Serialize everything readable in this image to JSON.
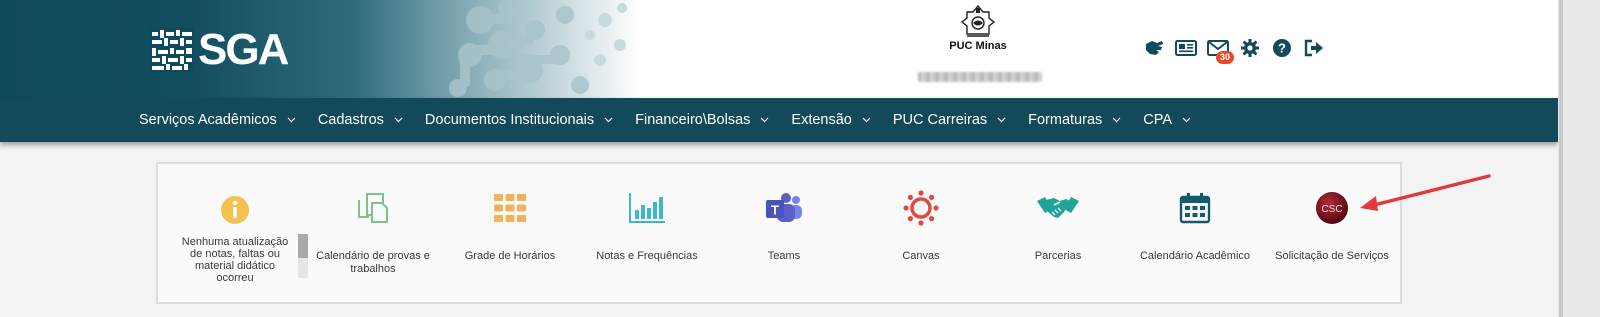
{
  "header": {
    "logo_text": "SGA",
    "institution_name": "PUC Minas",
    "toolbar": [
      {
        "icon": "sign-language-icon"
      },
      {
        "icon": "newspaper-icon"
      },
      {
        "icon": "envelope-icon",
        "badge": "30"
      },
      {
        "icon": "gear-icon"
      },
      {
        "icon": "help-circle-icon"
      },
      {
        "icon": "sign-out-icon"
      }
    ]
  },
  "nav": {
    "items": [
      {
        "label": "Serviços Acadêmicos"
      },
      {
        "label": "Cadastros"
      },
      {
        "label": "Documentos Institucionais"
      },
      {
        "label": "Financeiro\\Bolsas"
      },
      {
        "label": "Extensão"
      },
      {
        "label": "PUC Carreiras"
      },
      {
        "label": "Formaturas"
      },
      {
        "label": "CPA"
      }
    ]
  },
  "shortcuts": {
    "notice": "Nenhuma atualização de notas, faltas ou material didático ocorreu",
    "items": [
      {
        "label": "Calendário de provas e trabalhos",
        "icon": "copy-documents-icon",
        "color": "#7cc28a"
      },
      {
        "label": "Grade de Horários",
        "icon": "grid-icon",
        "color": "#f0b35c"
      },
      {
        "label": "Notas e Frequências",
        "icon": "bar-chart-icon",
        "color": "#3fb6c9"
      },
      {
        "label": "Teams",
        "icon": "teams-icon",
        "color": "#5b5fc7"
      },
      {
        "label": "Canvas",
        "icon": "canvas-icon",
        "color": "#e24a3b"
      },
      {
        "label": "Parcerias",
        "icon": "handshake-icon",
        "color": "#1fa39a"
      },
      {
        "label": "Calendário Acadêmico",
        "icon": "calendar-icon",
        "color": "#145a6e"
      },
      {
        "label": "Solicitação de Serviços",
        "icon": "csc-icon",
        "color": "#7a0f1c",
        "icon_text": "CSC"
      }
    ]
  },
  "colors": {
    "nav_bg": "#134a5a",
    "brand_dark": "#0f4a5b",
    "badge": "#e8492a",
    "arrow": "#e23a3a"
  }
}
